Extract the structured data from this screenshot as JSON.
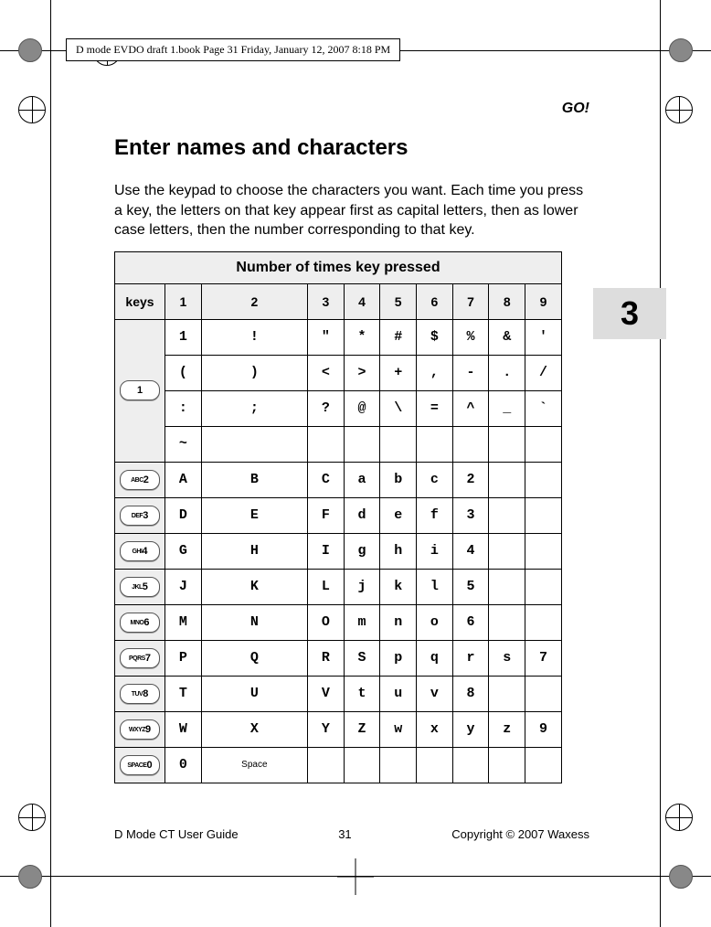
{
  "meta_header": "D mode EVDO draft 1.book  Page 31  Friday, January 12, 2007  8:18 PM",
  "running_head": "GO!",
  "heading": "Enter names and characters",
  "intro": "Use the keypad to choose the characters you want. Each time you press a key, the letters on that key appear first as capital letters, then as lower case letters, then the number corresponding to that key.",
  "section_number": "3",
  "table": {
    "title": "Number of times key pressed",
    "keys_label": "keys",
    "cols": [
      "1",
      "2",
      "3",
      "4",
      "5",
      "6",
      "7",
      "8",
      "9"
    ],
    "key1_rows": [
      [
        "1",
        "!",
        "\"",
        "*",
        "#",
        "$",
        "%",
        "&",
        "'"
      ],
      [
        "(",
        ")",
        "<",
        ">",
        "+",
        ",",
        "-",
        ".",
        "/"
      ],
      [
        ":",
        ";",
        "?",
        "@",
        "\\",
        "=",
        "^",
        "_",
        "`"
      ],
      [
        "~",
        "",
        "",
        "",
        "",
        "",
        "",
        "",
        ""
      ]
    ],
    "rows": [
      {
        "keycap_small": "ABC",
        "keycap_num": "2",
        "cells": [
          "A",
          "B",
          "C",
          "a",
          "b",
          "c",
          "2",
          "",
          ""
        ]
      },
      {
        "keycap_small": "DEF",
        "keycap_num": "3",
        "cells": [
          "D",
          "E",
          "F",
          "d",
          "e",
          "f",
          "3",
          "",
          ""
        ]
      },
      {
        "keycap_small": "GHI",
        "keycap_num": "4",
        "cells": [
          "G",
          "H",
          "I",
          "g",
          "h",
          "i",
          "4",
          "",
          ""
        ]
      },
      {
        "keycap_small": "JKL",
        "keycap_num": "5",
        "cells": [
          "J",
          "K",
          "L",
          "j",
          "k",
          "l",
          "5",
          "",
          ""
        ]
      },
      {
        "keycap_small": "MNO",
        "keycap_num": "6",
        "cells": [
          "M",
          "N",
          "O",
          "m",
          "n",
          "o",
          "6",
          "",
          ""
        ]
      },
      {
        "keycap_small": "PQRS",
        "keycap_num": "7",
        "cells": [
          "P",
          "Q",
          "R",
          "S",
          "p",
          "q",
          "r",
          "s",
          "7"
        ]
      },
      {
        "keycap_small": "TUV",
        "keycap_num": "8",
        "cells": [
          "T",
          "U",
          "V",
          "t",
          "u",
          "v",
          "8",
          "",
          ""
        ]
      },
      {
        "keycap_small": "WXYZ",
        "keycap_num": "9",
        "cells": [
          "W",
          "X",
          "Y",
          "Z",
          "w",
          "x",
          "y",
          "z",
          "9"
        ]
      },
      {
        "keycap_small": "SPACE",
        "keycap_num": "0",
        "cells": [
          "0",
          "Space",
          "",
          "",
          "",
          "",
          "",
          "",
          ""
        ]
      }
    ]
  },
  "footer": {
    "left": "D Mode CT User Guide",
    "center": "31",
    "right": "Copyright © 2007 Waxess"
  }
}
